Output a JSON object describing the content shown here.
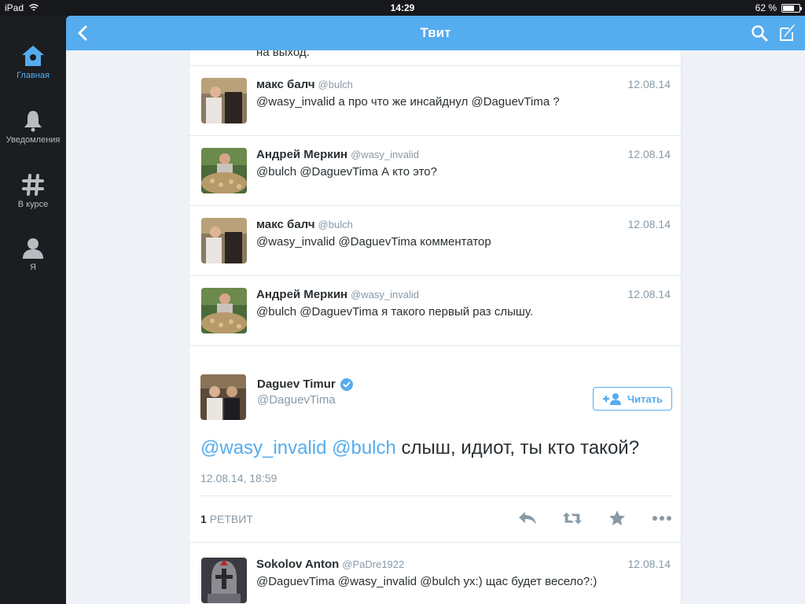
{
  "status_bar": {
    "device": "iPad",
    "time": "14:29",
    "battery": "62 %",
    "battery_level": 0.62
  },
  "sidebar": {
    "items": [
      {
        "label": "Главная",
        "icon": "home-icon",
        "active": true
      },
      {
        "label": "Уведомления",
        "icon": "bell-icon",
        "active": false
      },
      {
        "label": "В курсе",
        "icon": "hashtag-icon",
        "active": false
      },
      {
        "label": "Я",
        "icon": "person-icon",
        "active": false
      }
    ]
  },
  "topbar": {
    "title": "Твит",
    "back_icon": "back-chevron-icon",
    "search_icon": "search-icon",
    "compose_icon": "compose-icon"
  },
  "cut_tweet": {
    "text": "на выход."
  },
  "replies": [
    {
      "name": "макс балч",
      "handle": "@bulch",
      "date": "12.08.14",
      "text": "@wasy_invalid а про что же инсайднул @DaguevTima ?"
    },
    {
      "name": "Андрей Меркин",
      "handle": "@wasy_invalid",
      "date": "12.08.14",
      "text": "@bulch @DaguevTima А кто это?"
    },
    {
      "name": "макс балч",
      "handle": "@bulch",
      "date": "12.08.14",
      "text": "@wasy_invalid @DaguevTima комментатор"
    },
    {
      "name": "Андрей Меркин",
      "handle": "@wasy_invalid",
      "date": "12.08.14",
      "text": "@bulch @DaguevTima я такого первый раз слышу."
    }
  ],
  "main_tweet": {
    "name": "Daguev Timur",
    "handle": "@DaguevTima",
    "follow_label": "Читать",
    "mention1": "@wasy_invalid",
    "mention2": "@bulch",
    "text": "слыш, идиот, ты кто такой?",
    "timestamp": "12.08.14, 18:59",
    "retweet_count": "1",
    "retweet_label": "РЕТВИТ"
  },
  "last_reply": {
    "name": "Sokolov Anton",
    "handle": "@PaDre1922",
    "date": "12.08.14",
    "text": "@DaguevTima @wasy_invalid @bulch ух:) щас будет весело?:)"
  },
  "colors": {
    "accent": "#55acee",
    "sidebar_bg": "#1b1d21",
    "text": "#292f33",
    "muted": "#8899a6"
  }
}
